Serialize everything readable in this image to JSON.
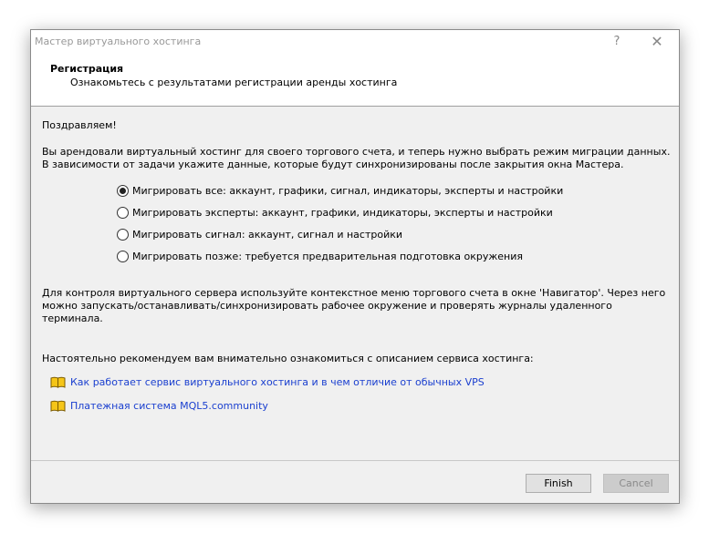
{
  "window": {
    "title": "Мастер виртуального хостинга",
    "help_glyph": "?",
    "close_glyph": "✕"
  },
  "header": {
    "title": "Регистрация",
    "subtitle": "Ознакомьтесь с результатами регистрации аренды хостинга"
  },
  "content": {
    "congrats": "Поздравляем!",
    "intro": "Вы арендовали виртуальный хостинг для своего торгового счета, и теперь нужно выбрать режим миграции данных. В зависимости от задачи укажите данные, которые будут синхронизированы после закрытия окна Мастера.",
    "options": [
      {
        "label": "Мигрировать все: аккаунт, графики, сигнал, индикаторы, эксперты и настройки",
        "checked": true
      },
      {
        "label": "Мигрировать эксперты: аккаунт, графики, индикаторы, эксперты и настройки",
        "checked": false
      },
      {
        "label": "Мигрировать сигнал: аккаунт, сигнал и настройки",
        "checked": false
      },
      {
        "label": "Мигрировать позже: требуется предварительная подготовка окружения",
        "checked": false
      }
    ],
    "navigator_note": "Для контроля виртуального сервера используйте контекстное меню торгового счета в окне 'Навигатор'. Через него можно запускать/останавливать/синхронизировать рабочее окружение и проверять журналы удаленного терминала.",
    "recommend": "Настоятельно рекомендуем вам внимательно ознакомиться с описанием сервиса хостинга:",
    "links": [
      {
        "label": "Как работает сервис виртуального хостинга и в чем отличие от обычных VPS",
        "icon": "book-icon"
      },
      {
        "label": "Платежная система MQL5.community",
        "icon": "book-icon"
      }
    ],
    "link_color": "#1a3fcf"
  },
  "footer": {
    "finish_label": "Finish",
    "cancel_label": "Cancel"
  }
}
